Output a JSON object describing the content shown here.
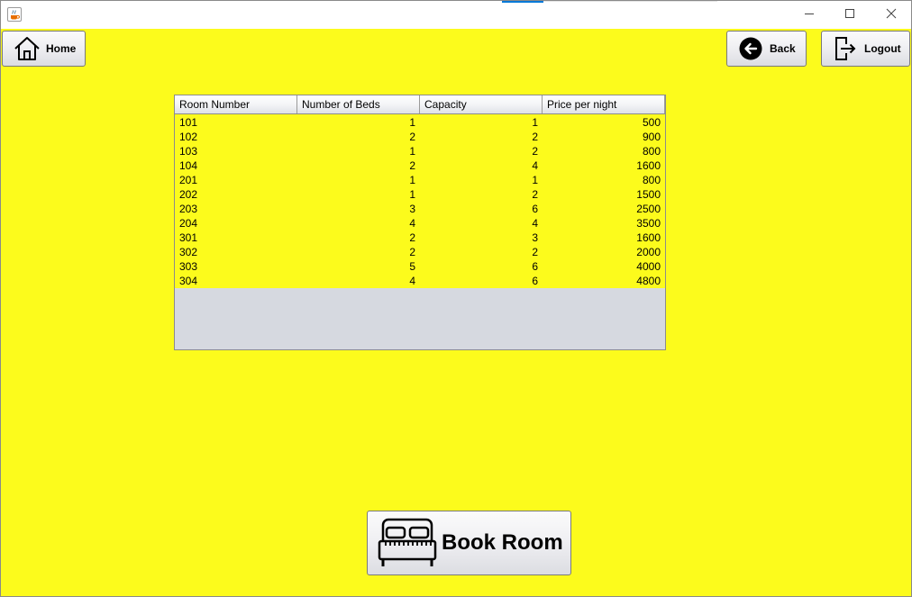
{
  "toolbar": {
    "home_label": "Home",
    "back_label": "Back",
    "logout_label": "Logout"
  },
  "icons": {
    "app": "java-cup-icon",
    "home": "house-icon",
    "back": "arrow-left-circle-icon",
    "logout": "logout-door-icon",
    "book": "bed-icon"
  },
  "colors": {
    "background": "#fcfb1c",
    "table_empty_area": "#d6d9e0",
    "accent": "#0078d7"
  },
  "table": {
    "columns": [
      "Room Number",
      "Number of Beds",
      "Capacity",
      "Price per night"
    ],
    "rows": [
      [
        "101",
        "1",
        "1",
        "500"
      ],
      [
        "102",
        "2",
        "2",
        "900"
      ],
      [
        "103",
        "1",
        "2",
        "800"
      ],
      [
        "104",
        "2",
        "4",
        "1600"
      ],
      [
        "201",
        "1",
        "1",
        "800"
      ],
      [
        "202",
        "1",
        "2",
        "1500"
      ],
      [
        "203",
        "3",
        "6",
        "2500"
      ],
      [
        "204",
        "4",
        "4",
        "3500"
      ],
      [
        "301",
        "2",
        "3",
        "1600"
      ],
      [
        "302",
        "2",
        "2",
        "2000"
      ],
      [
        "303",
        "5",
        "6",
        "4000"
      ],
      [
        "304",
        "4",
        "6",
        "4800"
      ]
    ]
  },
  "book_button": {
    "label": "Book Room"
  }
}
